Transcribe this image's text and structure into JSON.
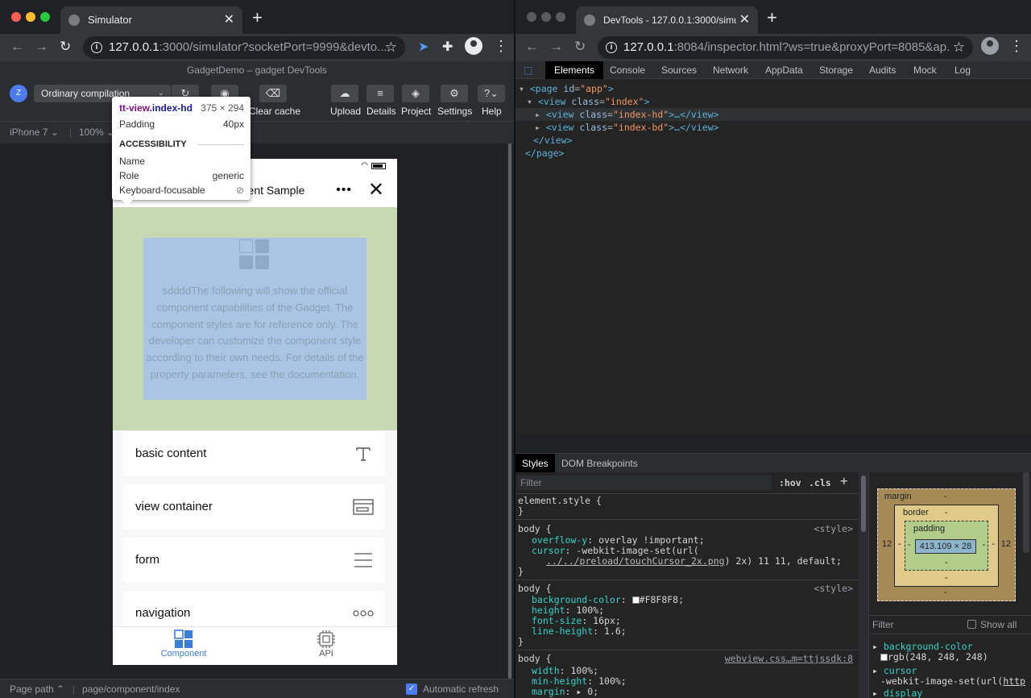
{
  "left_window": {
    "tab_title": "Simulator",
    "url_host": "127.0.0.1",
    "url_path": ":3000/simulator?socketPort=9999&devto...",
    "devtools_title": "GadgetDemo – gadget DevTools",
    "avatar_letter": "Z",
    "compile_mode": "Ordinary compilation",
    "toolbar": {
      "clear_cache": "Clear cache",
      "upload": "Upload",
      "details": "Details",
      "project": "Project",
      "settings": "Settings",
      "help": "Help"
    },
    "device": "iPhone 7",
    "zoom": "100%",
    "footer": {
      "page_path_label": "Page path",
      "page_path_value": "page/component/index",
      "auto_refresh": "Automatic refresh"
    }
  },
  "tooltip": {
    "selector_tag": "tt-view",
    "selector_class": ".index-hd",
    "size": "375 × 294",
    "padding_label": "Padding",
    "padding_value": "40px",
    "section": "ACCESSIBILITY",
    "name_label": "Name",
    "role_label": "Role",
    "role_value": "generic",
    "keyboard_label": "Keyboard-focusable"
  },
  "phone": {
    "title": "Component Sample",
    "title_visible": "ent Sample",
    "header_text": "sddddThe following will show the official component capabilities of the Gadget. The component styles are for reference only. The developer can customize the component style according to their own needs. For details of the property parameters, see the documentation.",
    "items": [
      {
        "label": "basic content",
        "icon": "text-t-icon"
      },
      {
        "label": "view container",
        "icon": "view-container-icon"
      },
      {
        "label": "form",
        "icon": "form-lines-icon"
      },
      {
        "label": "navigation",
        "icon": "more-dots-icon"
      }
    ],
    "tabs": [
      {
        "label": "Component",
        "icon": "component-grid-icon",
        "active": true
      },
      {
        "label": "API",
        "icon": "chip-icon",
        "active": false
      }
    ],
    "colors": {
      "active_tab": "#3b7ddd",
      "header_bg": "#c6d9b2",
      "content_highlight": "#a9c5e3"
    }
  },
  "right_window": {
    "tab_title": "DevTools - 127.0.0.1:3000/simu",
    "url_host": "127.0.0.1",
    "url_path": ":8084/inspector.html?ws=true&proxyPort=8085&ap...",
    "tabs": [
      "Elements",
      "Console",
      "Sources",
      "Network",
      "AppData",
      "Storage",
      "Audits",
      "Mock",
      "Log"
    ],
    "active_tab": "Elements",
    "dom": [
      {
        "text_tag": "<page ",
        "attr": "id",
        "val": "\"app\"",
        "end": ">"
      },
      {
        "text_tag": "<view ",
        "attr": "class",
        "val": "\"index\"",
        "end": ">"
      },
      {
        "text_tag": "<view ",
        "attr": "class",
        "val": "\"index-hd\"",
        "end": ">…</view>"
      },
      {
        "text_tag": "<view ",
        "attr": "class",
        "val": "\"index-bd\"",
        "end": ">…</view>"
      },
      {
        "text_tag": "</view>",
        "attr": "",
        "val": "",
        "end": ""
      },
      {
        "text_tag": "</page>",
        "attr": "",
        "val": "",
        "end": ""
      }
    ],
    "styles_tabs": [
      "Styles",
      "DOM Breakpoints"
    ],
    "filter_placeholder": "Filter",
    "hov": ":hov",
    "cls": ".cls",
    "add": "+",
    "styles": {
      "element_style": "element.style {",
      "close": "}",
      "body_sel": "body {",
      "src_style": "<style>",
      "rule1": {
        "p1": "overflow-y",
        "v1": "overlay !important;",
        "p2": "cursor",
        "v2": "-webkit-image-set(url(",
        "v2b_link": "../../preload/touchCursor_2x.png",
        "v2b_rest": ") 2x) 11 11, default;"
      },
      "rule2": {
        "p1": "background-color",
        "v1": "#F8F8F8;",
        "p2": "height",
        "v2": "100%;",
        "p3": "font-size",
        "v3": "16px;",
        "p4": "line-height",
        "v4": "1.6;"
      },
      "rule3": {
        "src": "webview.css…m=ttjssdk:8",
        "p1": "width",
        "v1": "100%;",
        "p2": "min-height",
        "v2": "100%;",
        "p3": "margin",
        "v3": "0;"
      }
    },
    "box_model": {
      "margin_label": "margin",
      "border_label": "border",
      "padding_label": "padding",
      "content": "413.109 × 28",
      "dash": "-",
      "left_margin": "12",
      "right_margin": "12"
    },
    "computed": {
      "filter": "Filter",
      "show_all": "Show all",
      "p1": "background-color",
      "v1": "rgb(248, 248, 248)",
      "p2": "cursor",
      "v2": "-webkit-image-set(url(",
      "v2_link": "http",
      "p3": "display"
    }
  }
}
